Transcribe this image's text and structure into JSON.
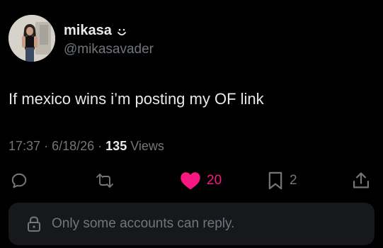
{
  "author": {
    "display_name": "mikasa",
    "handle": "@mikasavader",
    "name_icon": "smile-icon",
    "avatar_icon": "profile-photo"
  },
  "tweet": {
    "text": "If mexico wins i’m posting my OF link"
  },
  "meta": {
    "time": "17:37",
    "separator": "·",
    "date": "6/18/26",
    "views_count": "135",
    "views_label": "Views"
  },
  "actions": {
    "reply": {
      "icon": "reply-bubble-icon",
      "count": ""
    },
    "retweet": {
      "icon": "retweet-icon",
      "count": ""
    },
    "like": {
      "icon": "heart-icon",
      "count": "20",
      "liked": true
    },
    "bookmark": {
      "icon": "bookmark-icon",
      "count": "2"
    },
    "share": {
      "icon": "share-icon",
      "count": ""
    }
  },
  "reply_restriction": {
    "icon": "lock-icon",
    "text": "Only some accounts can reply."
  },
  "colors": {
    "background": "#000000",
    "primary_text": "#e7e9ea",
    "secondary_text": "#71767b",
    "like_pink": "#f91880",
    "reply_bar_bg": "#16181c"
  }
}
